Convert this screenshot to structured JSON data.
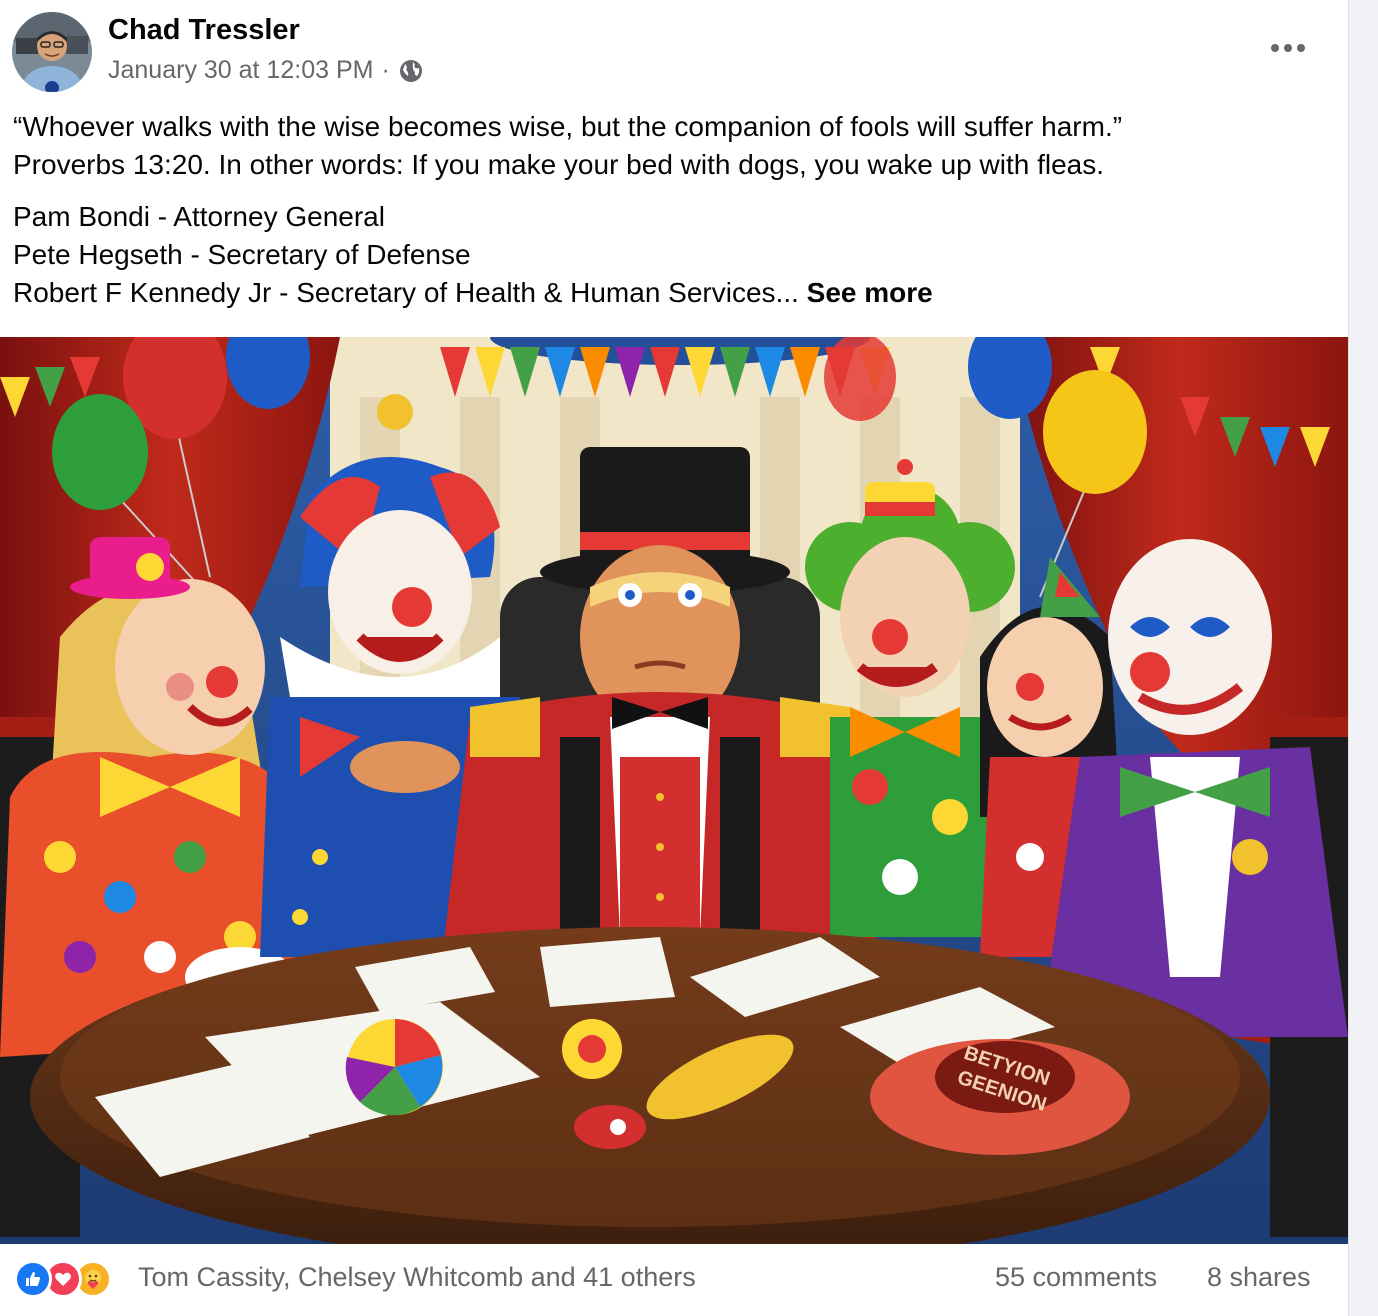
{
  "post": {
    "author": "Chad Tressler",
    "timestamp": "January 30 at 12:03 PM",
    "separator": "·",
    "audience_icon": "globe-icon",
    "more_icon": "more-horizontal-icon",
    "text_line1": "“Whoever walks with the wise becomes wise, but the companion of fools will suffer harm.”",
    "text_line2": "Proverbs 13:20.  In other words:  If you make your bed with dogs, you wake up with fleas.",
    "list_line1": "Pam Bondi - Attorney General",
    "list_line2": "Pete Hegseth - Secretary of Defense",
    "list_line3": "Robert F Kennedy Jr - Secretary of Health & Human Services...",
    "see_more": "See more"
  },
  "image": {
    "pillow_text_line1": "BETYION",
    "pillow_text_line2": "GEENION"
  },
  "footer": {
    "reaction_icons": [
      "like-icon",
      "love-icon",
      "care-icon"
    ],
    "reactors": "Tom Cassity, Chelsey Whitcomb and 41 others",
    "comments": "55 comments",
    "shares": "8 shares"
  },
  "colors": {
    "text_primary": "#050505",
    "text_secondary": "#65676b",
    "like_blue": "#1877f2",
    "love_red": "#f33e58",
    "care_yellow": "#f7b125",
    "page_background": "#f0f2f5"
  }
}
